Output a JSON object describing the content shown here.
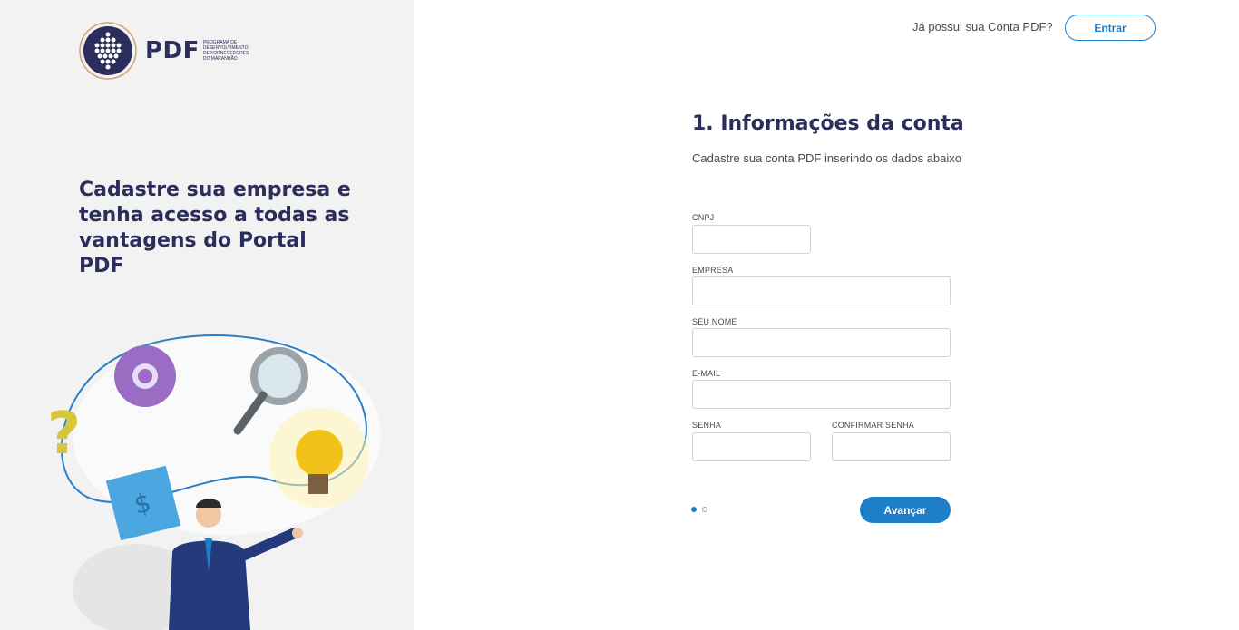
{
  "brand": {
    "logo_text": "PDF",
    "logo_subtitle": "Programa de Desenvolvimento de Fornecedores do Maranhão"
  },
  "left_panel": {
    "tagline": "Cadastre sua empresa e tenha acesso a todas as vantagens do Portal PDF"
  },
  "header": {
    "question": "Já possui sua Conta PDF?",
    "login_label": "Entrar"
  },
  "form": {
    "title": "1. Informações da conta",
    "subtitle": "Cadastre sua conta PDF inserindo os dados abaixo",
    "fields": {
      "cnpj": {
        "label": "CNPJ",
        "value": ""
      },
      "empresa": {
        "label": "EMPRESA",
        "value": ""
      },
      "nome": {
        "label": "SEU NOME",
        "value": ""
      },
      "email": {
        "label": "E-MAIL",
        "value": ""
      },
      "senha": {
        "label": "SENHA",
        "value": ""
      },
      "confirmar_senha": {
        "label": "CONFIRMAR SENHA",
        "value": ""
      }
    },
    "steps": {
      "current": 1,
      "total": 2
    },
    "next_label": "Avançar"
  },
  "colors": {
    "primary": "#1e7fc9",
    "navy": "#2b2d5a",
    "left_bg": "#f2f2f2"
  }
}
